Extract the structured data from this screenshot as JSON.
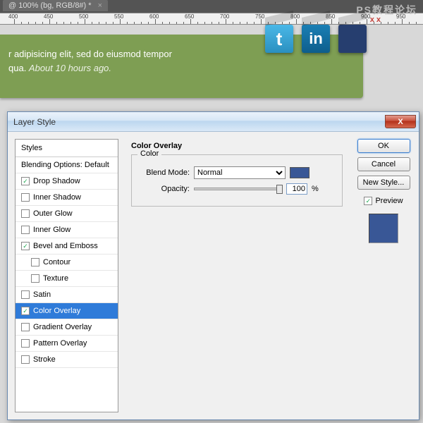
{
  "watermark": "PS教程论坛",
  "tab": {
    "title": "@ 100% (bg, RGB/8#) *",
    "close": "×"
  },
  "ruler_ticks": [
    400,
    450,
    500,
    550,
    600,
    650,
    700,
    750,
    800,
    850,
    900,
    950
  ],
  "annotation_color": "#263e6f",
  "markers": "x x",
  "canvas": {
    "line1": "r adipisicing elit, sed do eiusmod tempor",
    "line2_a": "qua.  ",
    "line2_b": "About 10 hours ago."
  },
  "social": {
    "twitter": "t",
    "linkedin": "in"
  },
  "dialog": {
    "title": "Layer Style",
    "close": "X",
    "styles_header": "Styles",
    "blending": "Blending Options: Default",
    "items": [
      {
        "label": "Drop Shadow",
        "checked": true,
        "indent": false
      },
      {
        "label": "Inner Shadow",
        "checked": false,
        "indent": false
      },
      {
        "label": "Outer Glow",
        "checked": false,
        "indent": false
      },
      {
        "label": "Inner Glow",
        "checked": false,
        "indent": false
      },
      {
        "label": "Bevel and Emboss",
        "checked": true,
        "indent": false
      },
      {
        "label": "Contour",
        "checked": false,
        "indent": true
      },
      {
        "label": "Texture",
        "checked": false,
        "indent": true
      },
      {
        "label": "Satin",
        "checked": false,
        "indent": false
      },
      {
        "label": "Color Overlay",
        "checked": true,
        "indent": false,
        "selected": true
      },
      {
        "label": "Gradient Overlay",
        "checked": false,
        "indent": false
      },
      {
        "label": "Pattern Overlay",
        "checked": false,
        "indent": false
      },
      {
        "label": "Stroke",
        "checked": false,
        "indent": false
      }
    ],
    "panel_title": "Color Overlay",
    "legend": "Color",
    "blend_label": "Blend Mode:",
    "blend_value": "Normal",
    "opacity_label": "Opacity:",
    "opacity_value": "100",
    "opacity_unit": "%",
    "color_annot": "#395796",
    "swatch_color": "#395796",
    "buttons": {
      "ok": "OK",
      "cancel": "Cancel",
      "new_style": "New Style..."
    },
    "preview_label": "Preview"
  }
}
